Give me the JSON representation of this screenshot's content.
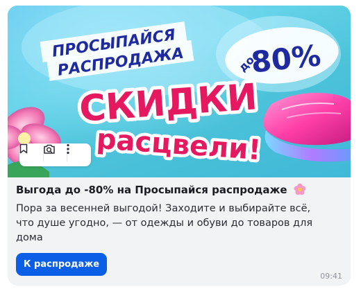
{
  "banner": {
    "headline_line1": "ПРОСЫПАЙСЯ",
    "headline_line2": "РАСПРОДАЖА",
    "discount_prefix": "до",
    "discount_value": "80%",
    "slogan_line1": "СКИДКИ",
    "slogan_line2": "расцвели!"
  },
  "toolbar": {
    "icons": [
      "bookmark-icon",
      "search-image-icon",
      "more-vertical-icon"
    ]
  },
  "post": {
    "title": "Выгода до -80% на Просыпайся распродаже",
    "description": "Пора за весенней выгодой! Заходите и выбирайте всё, что душе угодно, — от одежды и обуви до товаров для дома",
    "cta_label": "К распродаже",
    "time": "09:41"
  },
  "colors": {
    "accent": "#0b5fe6",
    "slogan": "#e5195f",
    "headline": "#1f2a9e",
    "card_bg": "#f2f3f5"
  }
}
